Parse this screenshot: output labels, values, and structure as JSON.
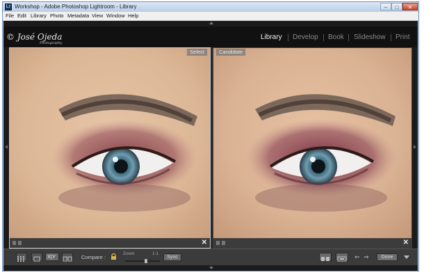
{
  "window": {
    "title": "Workshop - Adobe Photoshop Lightroom - Library",
    "app_icon_text": "Lr",
    "controls": {
      "minimize": "–",
      "maximize": "□",
      "close": "✕"
    }
  },
  "menubar": {
    "items": [
      "File",
      "Edit",
      "Library",
      "Photo",
      "Metadata",
      "View",
      "Window",
      "Help"
    ]
  },
  "identity_plate": {
    "name": "© José Ojeda",
    "subtitle": "Photography"
  },
  "modules": [
    "Library",
    "Develop",
    "Book",
    "Slideshow",
    "Print"
  ],
  "active_module": "Library",
  "compare": {
    "left_label": "Select",
    "right_label": "Candidate",
    "subject": "close-up eye with purple eyeshadow"
  },
  "toolbar": {
    "compare_label": "Compare :",
    "zoom_label": "Zoom",
    "zoom_value": "1:1",
    "sync_label": "Sync",
    "done_label": "Done",
    "view_mode_xy": "X|Y",
    "zoom_fraction": 0.6,
    "arrow_left": "⇐",
    "arrow_right": "⇒"
  },
  "colors": {
    "background": "#111111",
    "panel": "#3b3b3b",
    "active_module": "#f2f2f2",
    "inactive_module": "#8a8a8a"
  }
}
